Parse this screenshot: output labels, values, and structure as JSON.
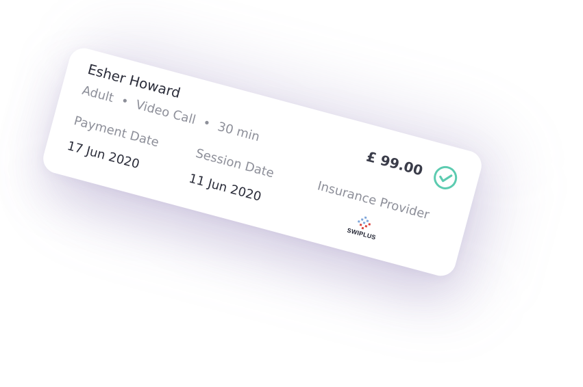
{
  "session_card": {
    "client_name": "Esher Howard",
    "client_type": "Adult",
    "session_type": "Video Call",
    "duration": "30 min",
    "separator": "•",
    "amount": "£ 99.00",
    "status_icon": "check-circle-icon",
    "payment_date_label": "Payment Date",
    "payment_date": "17 Jun 2020",
    "session_date_label": "Session Date",
    "session_date": "11 Jun 2020",
    "insurance_provider_label": "Insurance Provider",
    "insurance_provider_name": "SWIPLUS",
    "insurance_provider_logo_icon": "swiplus-logo-icon"
  },
  "colors": {
    "card_background": "#ffffff",
    "primary_text": "#2b2d3a",
    "secondary_text": "#8d8f99",
    "success_accent": "#5ccbb0",
    "logo_blue": "#7fa6d9",
    "logo_red": "#d9423b"
  }
}
